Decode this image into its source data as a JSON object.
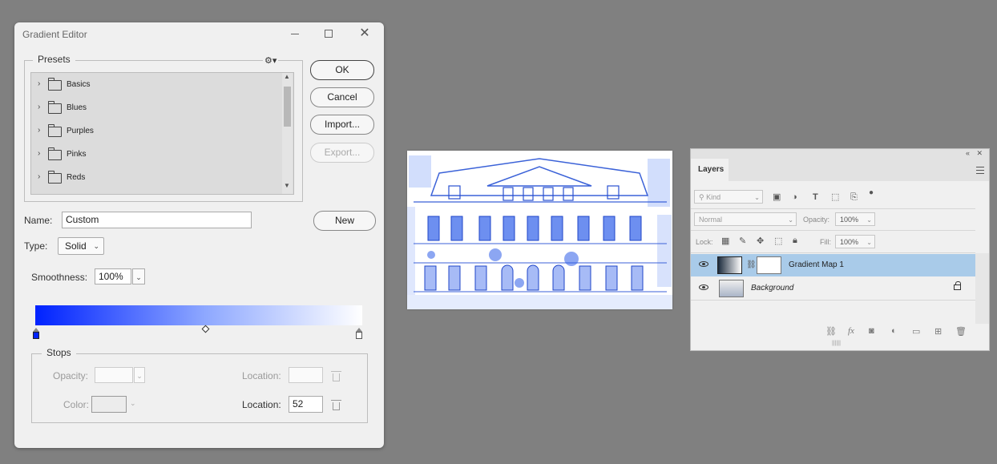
{
  "dialog": {
    "title": "Gradient Editor",
    "presets_label": "Presets",
    "presets": [
      {
        "label": "Basics"
      },
      {
        "label": "Blues"
      },
      {
        "label": "Purples"
      },
      {
        "label": "Pinks"
      },
      {
        "label": "Reds"
      }
    ],
    "buttons": {
      "ok": "OK",
      "cancel": "Cancel",
      "import": "Import...",
      "export": "Export...",
      "new": "New"
    },
    "name_label": "Name:",
    "name_value": "Custom",
    "type_label": "Type:",
    "type_value": "Solid",
    "smoothness_label": "Smoothness:",
    "smoothness_value": "100%",
    "gradient": {
      "start_color": "#0022ff",
      "end_color": "#ffffff",
      "midpoint_percent": 52
    },
    "stops": {
      "label": "Stops",
      "opacity_label": "Opacity:",
      "opacity_value": "",
      "opacity_location_label": "Location:",
      "opacity_location_value": "",
      "color_label": "Color:",
      "color_location_label": "Location:",
      "color_location_value": "52"
    }
  },
  "layers_panel": {
    "tab_label": "Layers",
    "filter_kind": "Kind",
    "blend_mode": "Normal",
    "opacity_label": "Opacity:",
    "opacity_value": "100%",
    "lock_label": "Lock:",
    "fill_label": "Fill:",
    "fill_value": "100%",
    "layers": [
      {
        "name": "Gradient Map 1",
        "selected": true
      },
      {
        "name": "Background",
        "selected": false
      }
    ],
    "bottom_icons": [
      "link-icon",
      "fx-icon",
      "mask-icon",
      "adjustment-icon",
      "group-icon",
      "new-layer-icon",
      "trash-icon"
    ]
  }
}
